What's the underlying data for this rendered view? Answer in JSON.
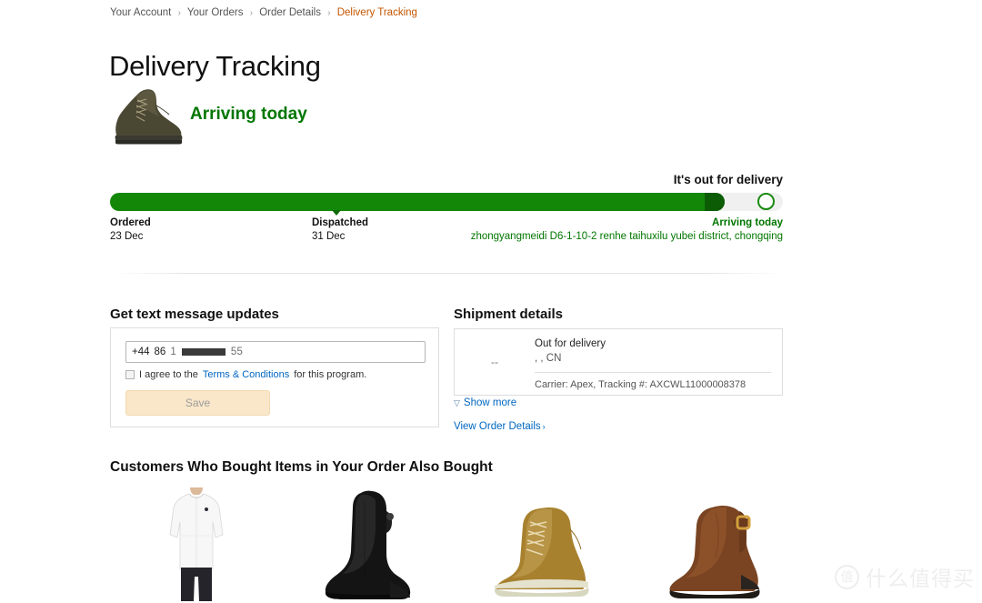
{
  "breadcrumb": {
    "items": [
      {
        "label": "Your Account",
        "current": false
      },
      {
        "label": "Your Orders",
        "current": false
      },
      {
        "label": "Order Details",
        "current": false
      },
      {
        "label": "Delivery Tracking",
        "current": true
      }
    ],
    "separator": "›"
  },
  "page_title": "Delivery Tracking",
  "hero": {
    "status_text": "Arriving today",
    "status_color": "#007600",
    "product_image_alt": "olive-hiking-boot"
  },
  "progress": {
    "out_for_delivery_label": "It's out for delivery",
    "fill_percent": 91,
    "marker_percent": 33,
    "milestones": [
      {
        "label": "Ordered",
        "sub": "23 Dec"
      },
      {
        "label": "Dispatched",
        "sub": "31 Dec"
      },
      {
        "label": "Arriving today",
        "sub": "zhongyangmeidi D6-1-10-2 renhe taihuxilu yubei district, chongqing"
      }
    ]
  },
  "sms": {
    "heading": "Get text message updates",
    "phone_country_code": "+44",
    "phone_prefix": "86",
    "phone_value": "1",
    "phone_suffix": "55",
    "agree_prefix": "I agree to the",
    "agree_link": "Terms & Conditions",
    "agree_suffix": "for this program.",
    "save_label": "Save",
    "checkbox_checked": false
  },
  "shipment": {
    "heading": "Shipment details",
    "date_cell": "--",
    "status": "Out for delivery",
    "location": ", , CN",
    "carrier_line": "Carrier: Apex, Tracking #: AXCWL11000008378",
    "show_more_label": "Show more",
    "show_more_icon": "chevron-down-icon",
    "view_order_label": "View Order Details",
    "view_order_arrow": "›"
  },
  "recommendations": {
    "heading": "Customers Who Bought Items in Your Order Also Bought",
    "items": [
      {
        "alt": "white-long-sleeve-compression-shirt"
      },
      {
        "alt": "black-tall-wedge-boot"
      },
      {
        "alt": "tan-lace-up-sneaker-boot"
      },
      {
        "alt": "brown-buckle-ankle-boot"
      }
    ]
  },
  "watermark": {
    "glyph": "值",
    "text": "什么值得买"
  }
}
